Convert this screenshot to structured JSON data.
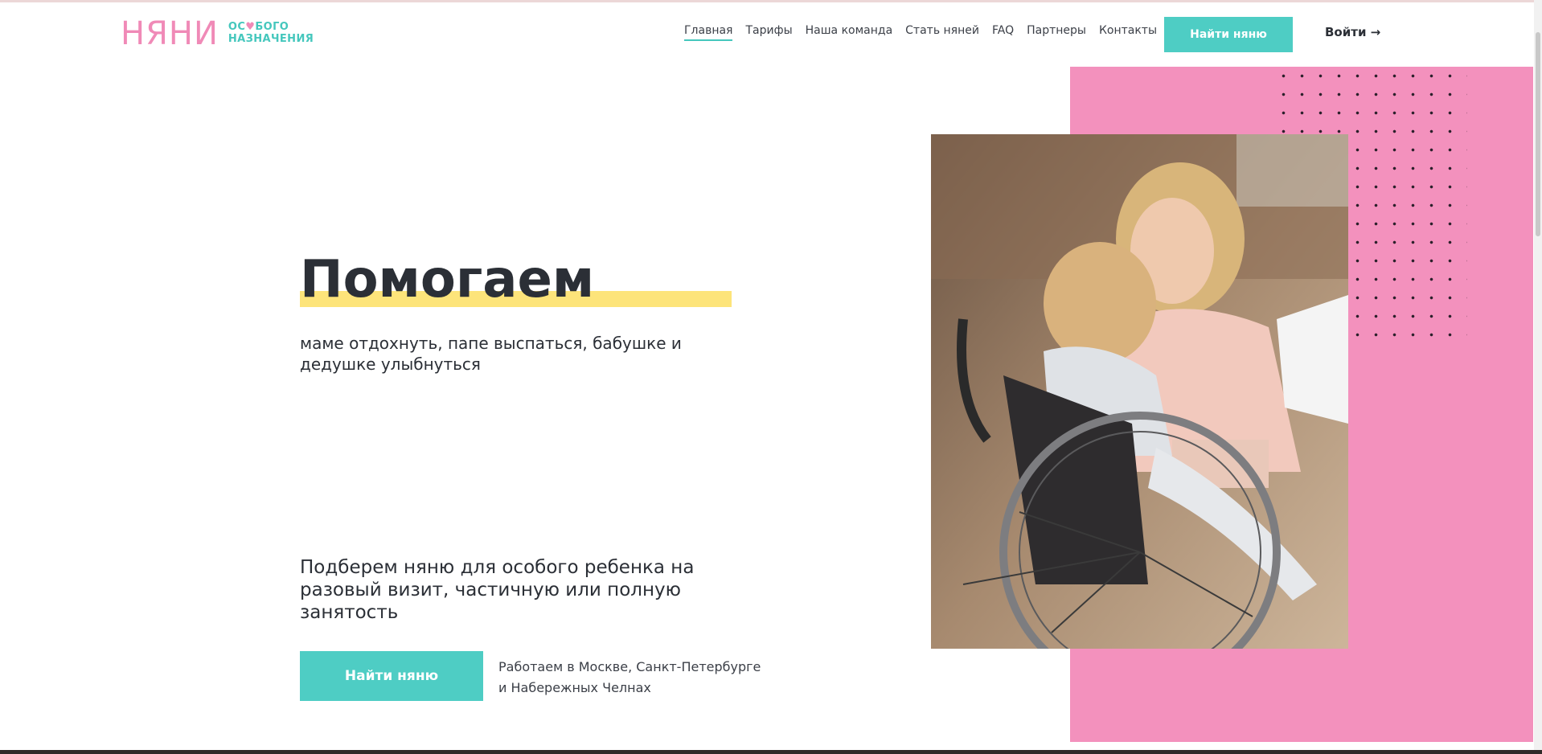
{
  "logo": {
    "main": "НЯНИ",
    "sub_line1_a": "ОС",
    "sub_line1_heart": "♥",
    "sub_line1_b": "БОГО",
    "sub_line2": "НАЗНАЧЕНИЯ"
  },
  "nav": {
    "items": [
      {
        "label": "Главная",
        "active": true
      },
      {
        "label": "Тарифы"
      },
      {
        "label": "Наша команда"
      },
      {
        "label": "Стать няней"
      },
      {
        "label": "FAQ"
      },
      {
        "label": "Партнеры"
      },
      {
        "label": "Контакты"
      }
    ],
    "cta": "Найти няню",
    "login": "Войти →"
  },
  "hero": {
    "title": "Помогаем",
    "subtitle": "маме отдохнуть, папе выспаться, бабушке и дедушке улыбнуться",
    "lead": "Подберем няню для особого ребенка на разовый визит, частичную или полную занятость",
    "button": "Найти няню",
    "cities_line1": "Работаем в Москве, Санкт-Петербурге",
    "cities_line2": "и Набережных Челнах"
  },
  "colors": {
    "accent": "#4ecdc4",
    "pink": "#f391bd",
    "highlight": "#fde47a",
    "text": "#2b2f36"
  }
}
